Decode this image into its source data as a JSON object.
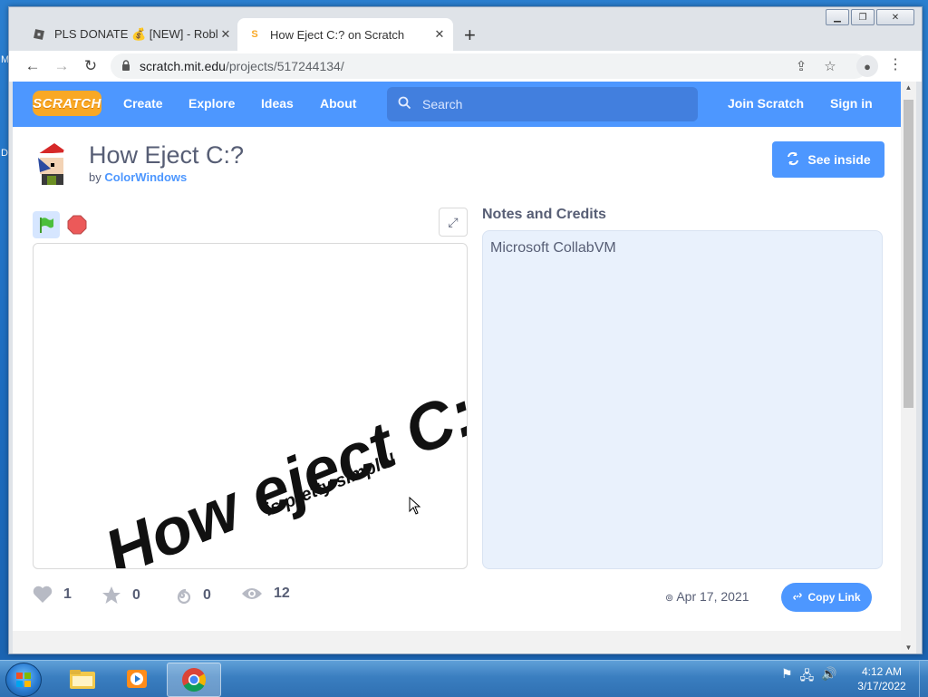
{
  "browser": {
    "tabs": [
      {
        "title": "PLS DONATE 💰 [NEW] - Roblox",
        "active": false
      },
      {
        "title": "How Eject C:? on Scratch",
        "active": true
      }
    ],
    "url_host": "scratch.mit.edu",
    "url_path": "/projects/517244134/"
  },
  "nav": {
    "logo": "SCRATCH",
    "links": [
      "Create",
      "Explore",
      "Ideas",
      "About"
    ],
    "search_placeholder": "Search",
    "join": "Join Scratch",
    "signin": "Sign in"
  },
  "project": {
    "title": "How Eject C:?",
    "by_label": "by",
    "author": "ColorWindows",
    "see_inside": "See inside",
    "stage_text_main": "How eject C: !",
    "stage_text_sub": "is pretty simple!",
    "notes_heading": "Notes and Credits",
    "notes_text": "Microsoft CollabVM",
    "stats": {
      "loves": "1",
      "favorites": "0",
      "remixes": "0",
      "views": "12"
    },
    "date": "Apr 17, 2021",
    "copy_link": "Copy Link"
  },
  "taskbar": {
    "time": "4:12 AM",
    "date": "3/17/2022"
  },
  "desktop_fragments": [
    "M",
    "D"
  ],
  "colors": {
    "scratch_blue": "#4d97ff",
    "text": "#575e75",
    "notes_bg": "#e9f1fc"
  }
}
